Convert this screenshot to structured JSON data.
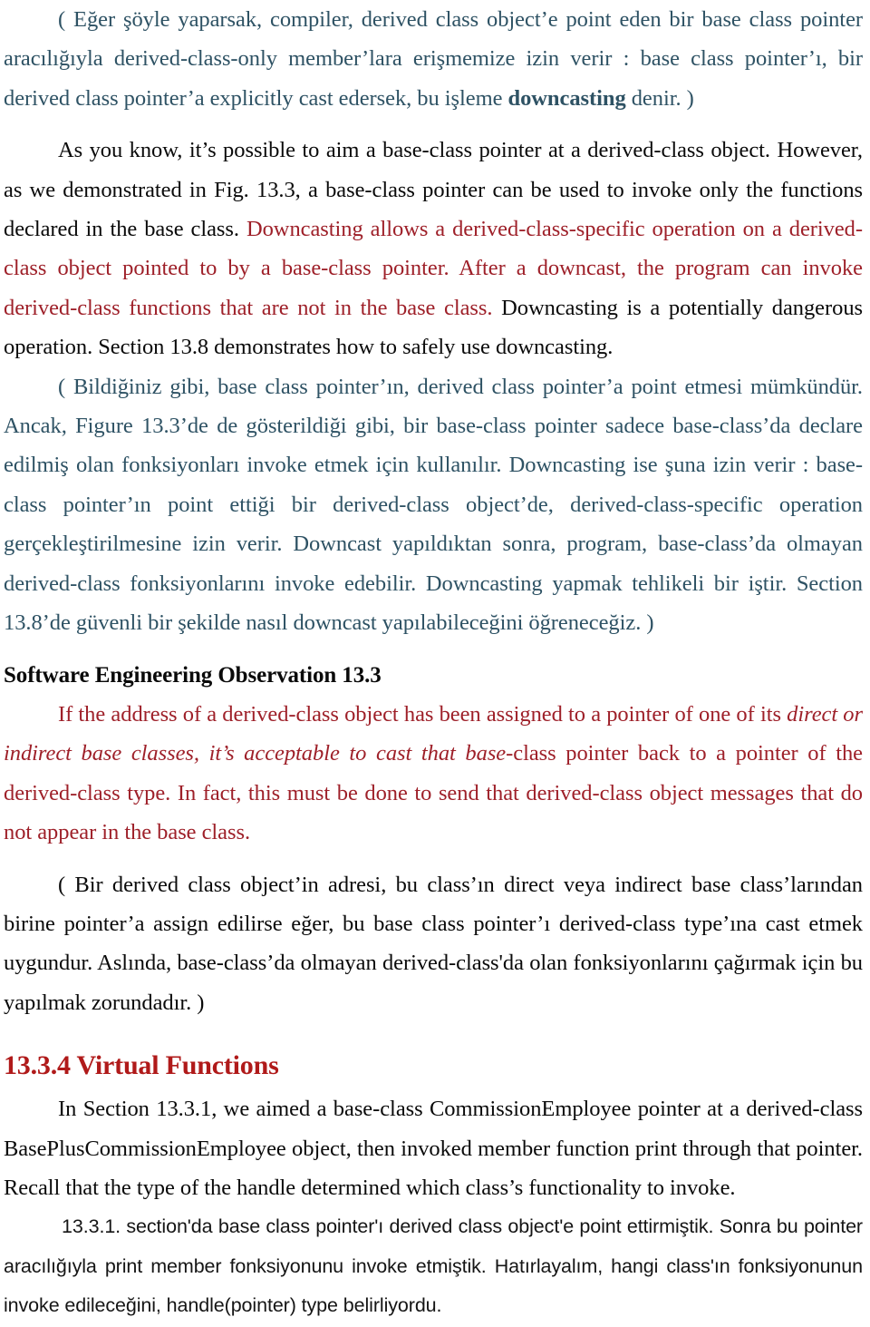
{
  "document": {
    "page_background": "#ffffff",
    "colors": {
      "turkish_teal": "#2e5264",
      "english_red": "#9e2029",
      "heading_red": "#b01a1a",
      "body_black": "#0a0a0a"
    }
  },
  "paragraphs": {
    "p1_turkish_teal": {
      "part1": "( Eğer şöyle yaparsak, compiler, derived class object’e point eden bir base class pointer aracılığıyla derived-class-only member’lara erişmemize izin verir : base class pointer’ı, bir derived class pointer’a explicitly cast edersek, bu işleme ",
      "bold_term": "downcasting",
      "part2": " denir.  )"
    },
    "p2_english": {
      "black1": "As you know, it’s possible to aim a base-class pointer at a derived-class object. However, as we demonstrated in Fig. 13.3, a base-class pointer can be used to invoke only the functions declared in the base class. ",
      "red1": "Downcasting allows a derived-class-specific operation on a derived-class object pointed to by a base-class pointer. After a downcast, the program can invoke derived-class functions that are not in the base class. ",
      "black2": "Downcasting is a potentially dangerous operation. Section 13.8 demonstrates how to safely use downcasting."
    },
    "p3_turkish_teal": {
      "text": "( Bildiğiniz gibi, base class pointer’ın, derived class pointer’a point etmesi mümkündür. Ancak, Figure 13.3’de de gösterildiği gibi, bir base-class pointer sadece base-class’da declare edilmiş olan fonksiyonları invoke etmek için kullanılır. Downcasting ise şuna izin verir : base-class pointer’ın point ettiği bir derived-class object’de, derived-class-specific operation gerçekleştirilmesine izin verir. Downcast yapıldıktan sonra, program, base-class’da olmayan derived-class fonksiyonlarını invoke edebilir. Downcasting yapmak tehlikeli bir iştir. Section 13.8’de güvenli bir şekilde nasıl downcast yapılabileceğini öğreneceğiz. )"
    },
    "observation_heading": "Software Engineering Observation 13.3",
    "p4_observation_red": {
      "upright1": "If the address of a derived-class object has been assigned to a pointer of one of its ",
      "italic": "direct or indirect base classes, it’s acceptable to cast that base",
      "upright2": "-class pointer back to a pointer of the derived-class type. In fact, this must be done to send that derived-class object messages that do not appear in the base class."
    },
    "p5_turkish_black": {
      "text": "( Bir derived class object’in adresi, bu class’ın direct veya indirect base class’larından birine pointer’a assign edilirse eğer, bu base class pointer’ı derived-class type’ına cast etmek uygundur. Aslında, base-class’da olmayan derived-class'da olan fonksiyonlarını çağırmak için bu yapılmak zorundadır. )"
    },
    "section_heading": "13.3.4 Virtual Functions",
    "p6_english_black": {
      "text": "In Section 13.3.1, we aimed a base-class CommissionEmployee pointer at a derived-class BasePlusCommissionEmployee object, then invoked member function print through that pointer. Recall that the type of the handle determined which class’s functionality to invoke."
    },
    "p7_turkish_sans": {
      "text": "13.3.1. section'da base class pointer'ı derived class object'e point ettirmiştik. Sonra bu pointer aracılığıyla print member fonksiyonunu invoke etmiştik. Hatırlayalım, hangi class'ın fonksiyonunun invoke edileceğini, handle(pointer) type belirliyordu."
    }
  }
}
